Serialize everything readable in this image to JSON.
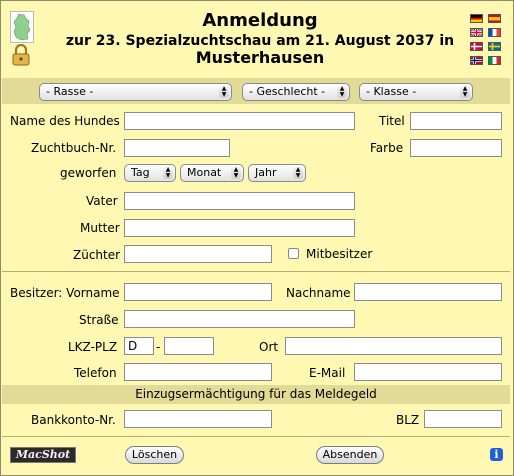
{
  "header": {
    "title": "Anmeldung",
    "subtitle": "zur 23. Spezialzuchtschau am 21. August 2037 in",
    "location": "Musterhausen"
  },
  "filters": {
    "breed": "- Rasse -",
    "sex": "- Geschlecht -",
    "class": "- Klasse -"
  },
  "dog": {
    "name_label": "Name des Hundes",
    "title_label": "Titel",
    "studbook_label": "Zuchtbuch-Nr.",
    "color_label": "Farbe",
    "born_label": "geworfen",
    "day": "Tag",
    "month": "Monat",
    "year": "Jahr",
    "father_label": "Vater",
    "mother_label": "Mutter",
    "breeder_label": "Züchter",
    "coowner_label": "Mitbesitzer"
  },
  "owner": {
    "firstname_label": "Besitzer: Vorname",
    "lastname_label": "Nachname",
    "street_label": "Straße",
    "zip_label": "LKZ-PLZ",
    "country_value": "D",
    "zip_dash": "-",
    "city_label": "Ort",
    "phone_label": "Telefon",
    "email_label": "E-Mail"
  },
  "payment": {
    "heading": "Einzugsermächtigung für das Meldegeld",
    "account_label": "Bankkonto-Nr.",
    "blz_label": "BLZ"
  },
  "footer": {
    "logo": "MacShot",
    "reset": "Löschen",
    "submit": "Absenden",
    "info": "i"
  },
  "icons": [
    "germany-map-icon",
    "lock-icon",
    "flag-de-icon",
    "flag-es-icon",
    "flag-uk-icon",
    "flag-fr-icon",
    "flag-dk-icon",
    "flag-se-icon",
    "flag-no-icon",
    "flag-it-icon"
  ],
  "colors": {
    "background": "#FEF8B2",
    "band": "#E2DB97",
    "info": "#1F5FD6"
  }
}
